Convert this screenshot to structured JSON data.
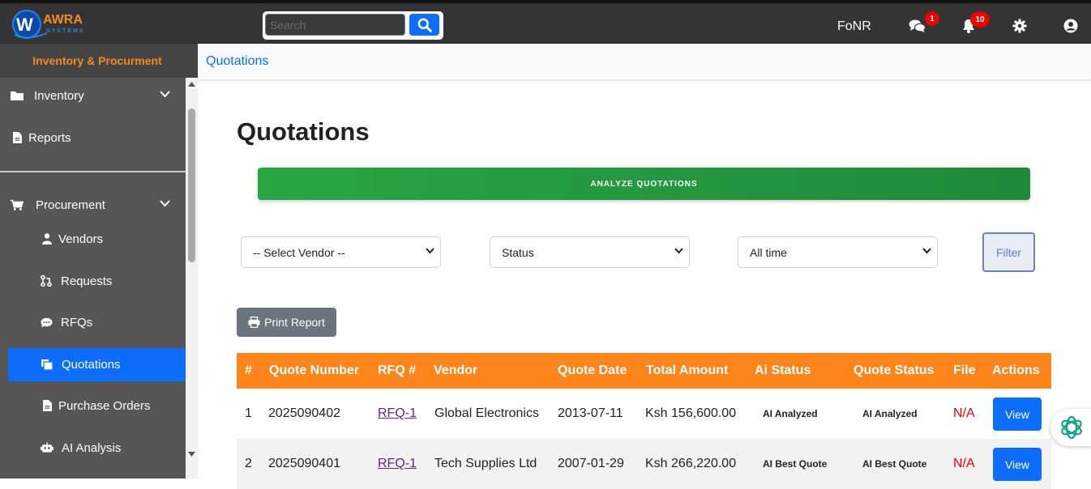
{
  "header": {
    "logo_text": "AWRA",
    "logo_subtext": "SYSTEMS",
    "search_placeholder": "Search",
    "username": "FoNR",
    "messages_badge": "1",
    "notifications_badge": "10"
  },
  "sidebar": {
    "title": "Inventory & Procurment",
    "items": [
      {
        "label": "Inventory"
      },
      {
        "label": "Reports"
      },
      {
        "label": "Procurement"
      },
      {
        "label": "Vendors"
      },
      {
        "label": "Requests"
      },
      {
        "label": "RFQs"
      },
      {
        "label": "Quotations"
      },
      {
        "label": "Purchase Orders"
      },
      {
        "label": "AI Analysis"
      }
    ]
  },
  "breadcrumb": "Quotations",
  "page_title": "Quotations",
  "analyze_button": "ANALYZE QUOTATIONS",
  "filters": {
    "vendor": "-- Select Vendor --",
    "status": "Status",
    "time": "All time",
    "filter_button": "Filter"
  },
  "print_button": "Print Report",
  "table": {
    "columns": [
      "#",
      "Quote Number",
      "RFQ #",
      "Vendor",
      "Quote Date",
      "Total Amount",
      "Ai Status",
      "Quote Status",
      "File",
      "Actions"
    ],
    "rows": [
      {
        "num": "1",
        "quote_number": "2025090402",
        "rfq": "RFQ-1",
        "vendor": "Global Electronics",
        "date": "2013-07-11",
        "amount": "Ksh 156,600.00",
        "ai_status": "AI Analyzed",
        "quote_status": "AI Analyzed",
        "file": "N/A",
        "action": "View"
      },
      {
        "num": "2",
        "quote_number": "2025090401",
        "rfq": "RFQ-1",
        "vendor": "Tech Supplies Ltd",
        "date": "2007-01-29",
        "amount": "Ksh 266,220.00",
        "ai_status": "AI Best Quote",
        "quote_status": "AI Best Quote",
        "file": "N/A",
        "action": "View"
      }
    ]
  },
  "colors": {
    "accent": "#0d6efd",
    "table_header": "#fd851b",
    "analyze": "#28a745",
    "sidebar": "#565656"
  }
}
